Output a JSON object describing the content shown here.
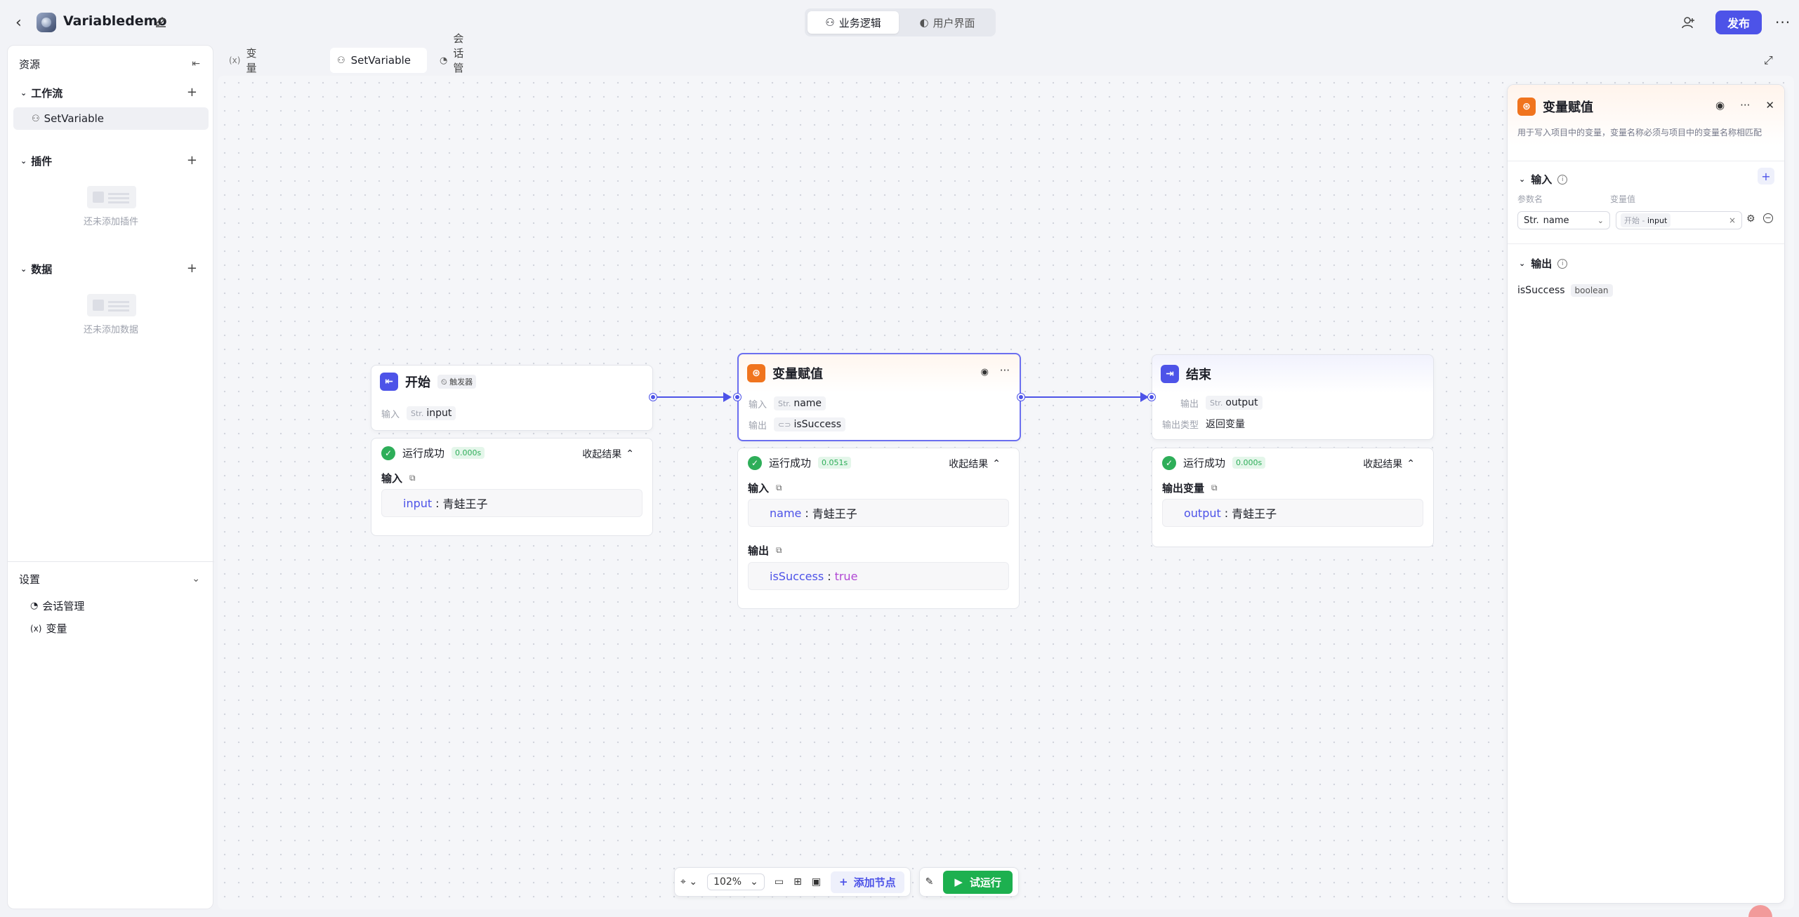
{
  "topbar": {
    "app_title": "Variabledemo",
    "seg_business": "业务逻辑",
    "seg_ui": "用户界面",
    "publish": "发布"
  },
  "sidebar": {
    "resources": "资源",
    "workflow_label": "工作流",
    "workflow_item": "SetVariable",
    "plugins_label": "插件",
    "plugins_empty": "还未添加插件",
    "data_label": "数据",
    "data_empty": "还未添加数据",
    "settings_label": "设置",
    "settings_items": [
      "会话管理",
      "变量"
    ]
  },
  "tabs": [
    {
      "label": "变量",
      "icon": "variable-icon"
    },
    {
      "label": "SetVariable",
      "icon": "workflow-icon",
      "active": true
    },
    {
      "label": "会话管理",
      "icon": "chat-icon"
    }
  ],
  "nodes": {
    "start": {
      "title": "开始",
      "badge": "触发器",
      "input_label": "输入",
      "input_type": "Str.",
      "input_name": "input",
      "result": {
        "status": "运行成功",
        "time": "0.000s",
        "collapse": "收起结果",
        "section": "输入",
        "key": "input",
        "value": "青蛙王子"
      }
    },
    "assign": {
      "title": "变量赋值",
      "input_label": "输入",
      "input_type": "Str.",
      "input_name": "name",
      "output_label": "输出",
      "output_name": "isSuccess",
      "result": {
        "status": "运行成功",
        "time": "0.051s",
        "collapse": "收起结果",
        "in_section": "输入",
        "in_key": "name",
        "in_value": "青蛙王子",
        "out_section": "输出",
        "out_key": "isSuccess",
        "out_value": "true"
      }
    },
    "end": {
      "title": "结束",
      "output_label": "输出",
      "output_type": "Str.",
      "output_name": "output",
      "output_type_label": "输出类型",
      "output_type_value": "返回变量",
      "result": {
        "status": "运行成功",
        "time": "0.000s",
        "collapse": "收起结果",
        "section": "输出变量",
        "key": "output",
        "value": "青蛙王子"
      }
    }
  },
  "panel": {
    "title": "变量赋值",
    "description": "用于写入项目中的变量，变量名称必须与项目中的变量名称相匹配",
    "input_section": "输入",
    "col_param": "参数名",
    "col_value": "变量值",
    "param_type": "Str.",
    "param_name": "name",
    "ref_source": "开始 -",
    "ref_var": "input",
    "output_section": "输出",
    "output_name": "isSuccess",
    "output_type": "boolean"
  },
  "toolbar": {
    "zoom": "102%",
    "add_node": "添加节点",
    "run": "试运行"
  },
  "colors": {
    "accent": "#4d53e8",
    "success": "#2eae59",
    "run": "#1db04f",
    "assign_icon": "#f0741e"
  }
}
